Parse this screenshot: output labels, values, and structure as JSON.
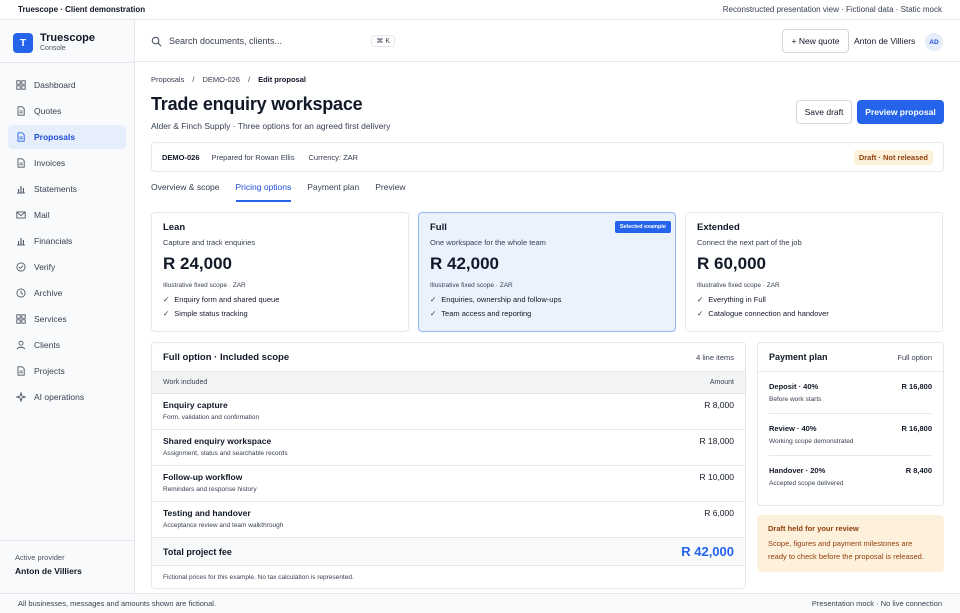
{
  "topbar": {
    "left": "Truescope · Client demonstration",
    "right": "Reconstructed presentation view · Fictional data · Static mock"
  },
  "brand": {
    "logo": "T",
    "name": "Truescope",
    "sub": "Console"
  },
  "sidebar": {
    "items": [
      {
        "label": "Dashboard",
        "icon": "grid-icon",
        "active": false
      },
      {
        "label": "Quotes",
        "icon": "document-icon",
        "active": false
      },
      {
        "label": "Proposals",
        "icon": "document-icon",
        "active": true
      },
      {
        "label": "Invoices",
        "icon": "document-icon",
        "active": false
      },
      {
        "label": "Statements",
        "icon": "bar-chart-icon",
        "active": false
      },
      {
        "label": "Mail",
        "icon": "mail-icon",
        "active": false
      },
      {
        "label": "Financials",
        "icon": "bar-chart-icon",
        "active": false
      },
      {
        "label": "Verify",
        "icon": "check-circle-icon",
        "active": false
      },
      {
        "label": "Archive",
        "icon": "clock-icon",
        "active": false
      },
      {
        "label": "Services",
        "icon": "grid-icon",
        "active": false
      },
      {
        "label": "Clients",
        "icon": "user-icon",
        "active": false
      },
      {
        "label": "Projects",
        "icon": "document-icon",
        "active": false
      },
      {
        "label": "AI operations",
        "icon": "sparkle-icon",
        "active": false
      }
    ],
    "provider_label": "Active provider",
    "provider_name": "Anton de Villiers"
  },
  "header": {
    "search_placeholder": "Search documents, clients...",
    "shortcut": "⌘ K",
    "new_quote": "+ New quote",
    "user_name": "Anton de Villiers",
    "avatar": "AD"
  },
  "breadcrumb": {
    "items": [
      "Proposals",
      "DEMO-026",
      "Edit proposal"
    ],
    "separator": "/"
  },
  "page": {
    "title": "Trade enquiry workspace",
    "subtitle": "Alder & Finch Supply · Three options for an agreed first delivery",
    "save_label": "Save draft",
    "preview_label": "Preview proposal"
  },
  "info": {
    "ref": "DEMO-026",
    "prepared": "Prepared for Rowan Ellis",
    "currency": "Currency: ZAR",
    "status": "Draft · Not released"
  },
  "tabs": [
    {
      "label": "Overview & scope",
      "active": false
    },
    {
      "label": "Pricing options",
      "active": true
    },
    {
      "label": "Payment plan",
      "active": false
    },
    {
      "label": "Preview",
      "active": false
    }
  ],
  "options": [
    {
      "name": "Lean",
      "desc": "Capture and track enquiries",
      "price": "R 24,000",
      "scope": "Illustrative fixed scope · ZAR",
      "features": [
        "Enquiry form and shared queue",
        "Simple status tracking"
      ],
      "selected": false,
      "badge": ""
    },
    {
      "name": "Full",
      "desc": "One workspace for the whole team",
      "price": "R 42,000",
      "scope": "Illustrative fixed scope · ZAR",
      "features": [
        "Enquiries, ownership and follow-ups",
        "Team access and reporting"
      ],
      "selected": true,
      "badge": "Selected example"
    },
    {
      "name": "Extended",
      "desc": "Connect the next part of the job",
      "price": "R 60,000",
      "scope": "Illustrative fixed scope · ZAR",
      "features": [
        "Everything in Full",
        "Catalogue connection and handover"
      ],
      "selected": false,
      "badge": ""
    }
  ],
  "scope": {
    "title": "Full option · Included scope",
    "count": "4 line items",
    "col_work": "Work included",
    "col_amount": "Amount",
    "rows": [
      {
        "title": "Enquiry capture",
        "sub": "Form, validation and confirmation",
        "amount": "R 8,000"
      },
      {
        "title": "Shared enquiry workspace",
        "sub": "Assignment, status and searchable records",
        "amount": "R 18,000"
      },
      {
        "title": "Follow-up workflow",
        "sub": "Reminders and response history",
        "amount": "R 10,000"
      },
      {
        "title": "Testing and handover",
        "sub": "Acceptance review and team walkthrough",
        "amount": "R 6,000"
      }
    ],
    "total_label": "Total project fee",
    "total_amount": "R 42,000",
    "note": "Fictional prices for this example. No tax calculation is represented."
  },
  "plan": {
    "title": "Payment plan",
    "label": "Full option",
    "rows": [
      {
        "name": "Deposit · 40%",
        "sub": "Before work starts",
        "amount": "R 16,800"
      },
      {
        "name": "Review · 40%",
        "sub": "Working scope demonstrated",
        "amount": "R 16,800"
      },
      {
        "name": "Handover · 20%",
        "sub": "Accepted scope delivered",
        "amount": "R 8,400"
      }
    ]
  },
  "review": {
    "title": "Draft held for your review",
    "body": "Scope, figures and payment milestones are ready to check before the proposal is released."
  },
  "footer": {
    "left": "All businesses, messages and amounts shown are fictional.",
    "right": "Presentation mock · No live connection"
  },
  "colors": {
    "accent": "#2563eb",
    "active_bg": "#e6eefb",
    "selected_card_bg": "#eaf2fd",
    "warning_bg": "#fdf1dc",
    "warning_text": "#92400e"
  }
}
